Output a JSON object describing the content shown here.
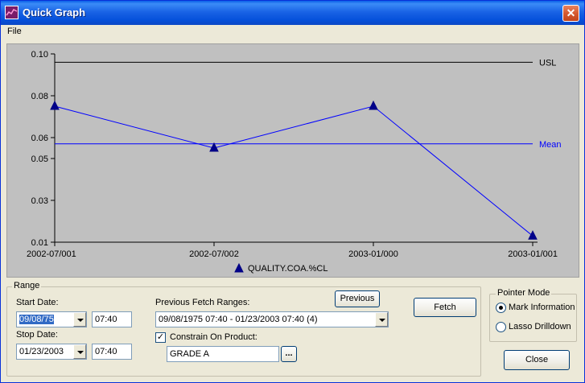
{
  "window": {
    "title": "Quick Graph",
    "close_glyph": "✕"
  },
  "menu": {
    "file": "File"
  },
  "chart_data": {
    "type": "line",
    "categories": [
      "2002-07/001",
      "2002-07/002",
      "2003-01/000",
      "2003-01/001"
    ],
    "series": [
      {
        "name": "QUALITY.COA.%CL",
        "values": [
          0.075,
          0.055,
          0.075,
          0.013
        ]
      }
    ],
    "reference_lines": [
      {
        "label": "USL",
        "value": 0.096,
        "color": "#000000"
      },
      {
        "label": "Mean",
        "value": 0.057,
        "color": "#0000ff"
      }
    ],
    "ylim": [
      0.01,
      0.1
    ],
    "yticks": [
      0.1,
      0.08,
      0.06,
      0.05,
      0.03,
      0.01
    ],
    "ytick_labels": [
      "0.10",
      "0.08",
      "0.06",
      "0.05",
      "0.03",
      "0.01"
    ],
    "line_color": "#0000ff",
    "marker_color": "#00008b",
    "legend_placement": "bottom-center",
    "grid": false
  },
  "range": {
    "title": "Range",
    "start_label": "Start Date:",
    "start_date": "09/08/75",
    "start_time": "07:40",
    "stop_label": "Stop Date:",
    "stop_date": "01/23/2003",
    "stop_time": "07:40",
    "prev_label": "Previous Fetch Ranges:",
    "prev_value": "09/08/1975 07:40 - 01/23/2003 07:40   (4)",
    "previous_button": "Previous",
    "fetch_button": "Fetch",
    "constrain_label": "Constrain On Product:",
    "constrain_checked": "✓",
    "product": "GRADE A",
    "browse_button": "..."
  },
  "pointer": {
    "title": "Pointer Mode",
    "mark": "Mark Information",
    "lasso": "Lasso Drilldown"
  },
  "close_button": "Close"
}
